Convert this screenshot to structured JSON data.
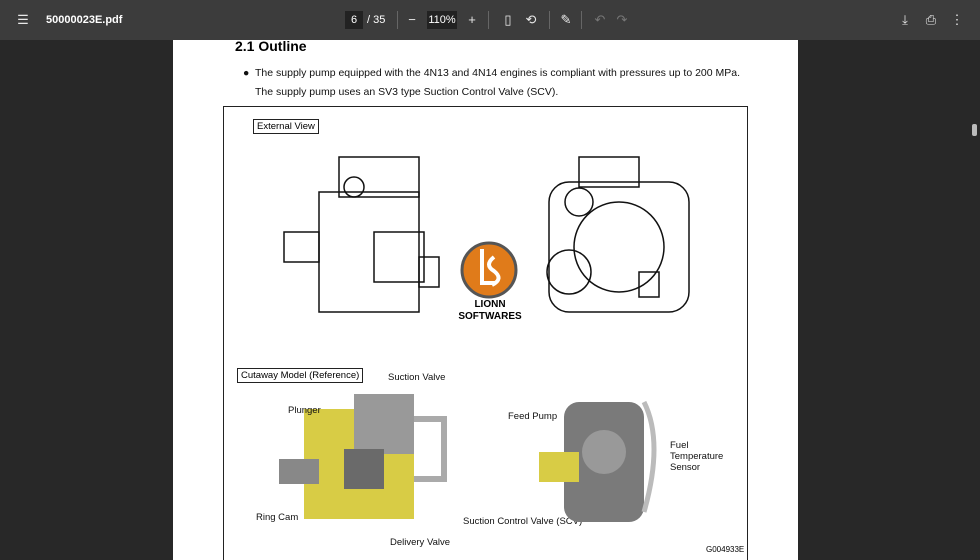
{
  "toolbar": {
    "menu_icon": "hamburger-menu-icon",
    "title": "50000023E.pdf",
    "page_current": "6",
    "page_total": "/ 35",
    "zoom": "110%",
    "zoom_out": "−",
    "zoom_in": "+"
  },
  "document": {
    "heading": "2.1  Outline",
    "bullet": "The supply pump equipped with the 4N13 and 4N14 engines is compliant with pressures up to 200 MPa.",
    "line2": "The supply pump uses an SV3 type Suction Control Valve (SCV).",
    "figure": {
      "external_label": "External View",
      "cutaway_label": "Cutaway Model (Reference)",
      "watermark": "LIONN SOFTWARES",
      "callouts": {
        "suction_valve": "Suction Valve",
        "plunger": "Plunger",
        "ring_cam": "Ring Cam",
        "delivery_valve": "Delivery Valve",
        "scv": "Suction Control Valve (SCV)",
        "feed_pump": "Feed Pump",
        "fuel_temp_1": "Fuel",
        "fuel_temp_2": "Temperature",
        "fuel_temp_3": "Sensor"
      },
      "code": "G004933E"
    }
  }
}
